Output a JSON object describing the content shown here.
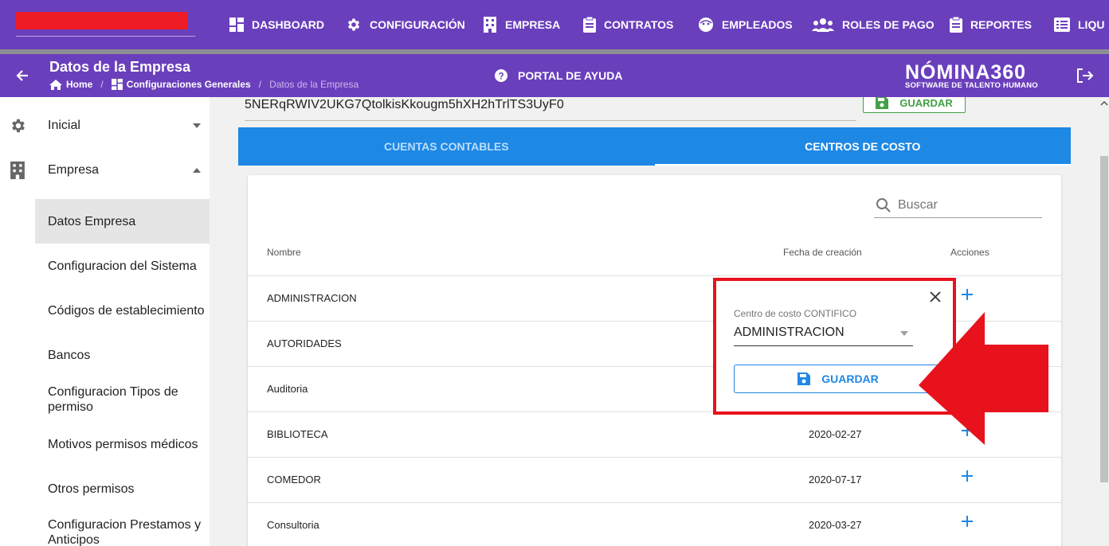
{
  "nav": {
    "items": [
      {
        "label": "DASHBOARD",
        "icon": "dashboard-icon"
      },
      {
        "label": "CONFIGURACIÓN",
        "icon": "gear-icon"
      },
      {
        "label": "EMPRESA",
        "icon": "building-icon"
      },
      {
        "label": "CONTRATOS",
        "icon": "clipboard-icon"
      },
      {
        "label": "EMPLEADOS",
        "icon": "face-icon"
      },
      {
        "label": "ROLES DE PAGO",
        "icon": "users-icon"
      },
      {
        "label": "REPORTES",
        "icon": "clipboard-icon"
      },
      {
        "label": "LIQU",
        "icon": "list-icon"
      }
    ]
  },
  "header": {
    "title": "Datos de la Empresa",
    "breadcrumb": [
      "Home",
      "Configuraciones Generales",
      "Datos de la Empresa"
    ],
    "help_label": "PORTAL DE AYUDA",
    "logo_main": "NÓMINA360",
    "logo_sub": "SOFTWARE DE TALENTO HUMANO"
  },
  "sidebar": {
    "sections": [
      {
        "label": "Inicial",
        "icon": "gear-icon"
      },
      {
        "label": "Empresa",
        "icon": "building-icon"
      }
    ],
    "items": [
      "Datos Empresa",
      "Configuracion del Sistema",
      "Códigos de establecimiento",
      "Bancos",
      "Configuracion Tipos de permiso",
      "Motivos permisos médicos",
      "Otros permisos",
      "Configuracion Prestamos y Anticipos"
    ]
  },
  "main": {
    "key_value": "5NERqRWIV2UKG7QtolkisKkougm5hXH2hTrlTS3UyF0",
    "save_label": "GUARDAR",
    "tabs": [
      "CUENTAS CONTABLES",
      "CENTROS DE COSTO"
    ],
    "active_tab": "CENTROS DE COSTO",
    "search_placeholder": "Buscar",
    "columns": [
      "Nombre",
      "Fecha de creación",
      "Acciones"
    ],
    "rows": [
      {
        "name": "ADMINISTRACION",
        "date": ""
      },
      {
        "name": "AUTORIDADES",
        "date": ""
      },
      {
        "name": "Auditoria",
        "date": ""
      },
      {
        "name": "BIBLIOTECA",
        "date": "2020-02-27"
      },
      {
        "name": "COMEDOR",
        "date": "2020-07-17"
      },
      {
        "name": "Consultoria",
        "date": "2020-03-27"
      }
    ]
  },
  "popup": {
    "label": "Centro de costo CONTIFICO",
    "value": "ADMINISTRACION",
    "save_label": "GUARDAR"
  },
  "colors": {
    "brand_purple": "#6a3fbc",
    "tab_blue": "#1e88e5",
    "highlight_red": "#e8121c",
    "save_green": "#43a047"
  }
}
